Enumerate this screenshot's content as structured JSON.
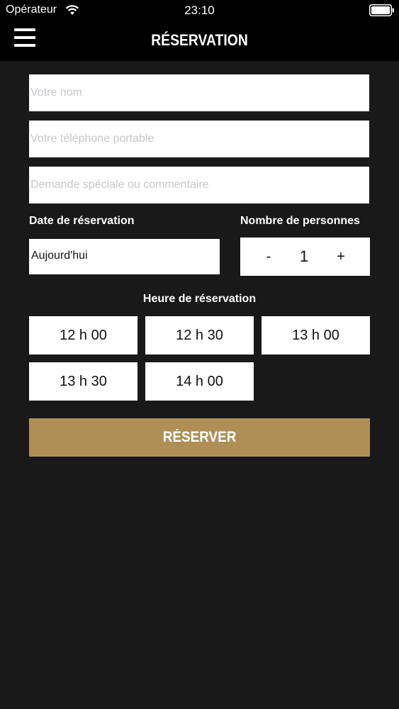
{
  "status_bar": {
    "carrier": "Opérateur",
    "time": "23:10",
    "wifi_icon": "wifi-icon",
    "battery_icon": "battery-icon"
  },
  "nav": {
    "menu_icon": "hamburger-menu-icon",
    "title": "RÉSERVATION"
  },
  "form": {
    "name_placeholder": "Votre nom",
    "name_value": "",
    "phone_placeholder": "Votre téléphone portable",
    "phone_value": "",
    "comment_placeholder": "Demande spéciale ou commentaire",
    "comment_value": "",
    "date_label": "Date de réservation",
    "date_value": "Aujourd'hui",
    "guests_label": "Nombre de personnes",
    "guests_minus": "-",
    "guests_value": "1",
    "guests_plus": "+",
    "time_label": "Heure de réservation",
    "time_slots": [
      "12 h 00",
      "12 h 30",
      "13 h 00",
      "13 h 30",
      "14 h 00"
    ],
    "submit_label": "RÉSERVER"
  },
  "colors": {
    "background": "#1a191a",
    "bars": "#000000",
    "accent": "#b08f57",
    "field": "#ffffff"
  }
}
